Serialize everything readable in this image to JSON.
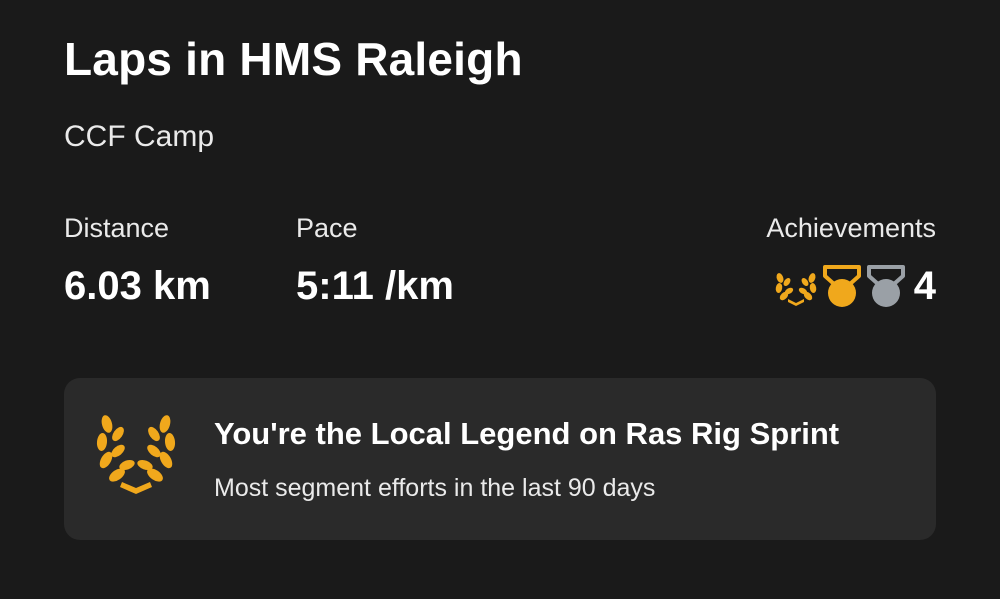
{
  "activity": {
    "title": "Laps in HMS Raleigh",
    "subtitle": "CCF Camp"
  },
  "stats": {
    "distance": {
      "label": "Distance",
      "value": "6.03 km"
    },
    "pace": {
      "label": "Pace",
      "value": "5:11 /km"
    },
    "achievements": {
      "label": "Achievements",
      "count": "4",
      "icons": [
        "local-legend-laurel-icon",
        "gold-medal-icon",
        "silver-medal-icon"
      ]
    }
  },
  "legend_banner": {
    "heading": "You're the Local Legend on Ras Rig Sprint",
    "description": "Most segment efforts in the last 90 days",
    "icon": "laurel-wreath-icon"
  },
  "colors": {
    "background": "#1a1a1a",
    "card": "#2a2a2a",
    "gold": "#f0a81c",
    "silver": "#9aa0a6",
    "text": "#ffffff"
  }
}
